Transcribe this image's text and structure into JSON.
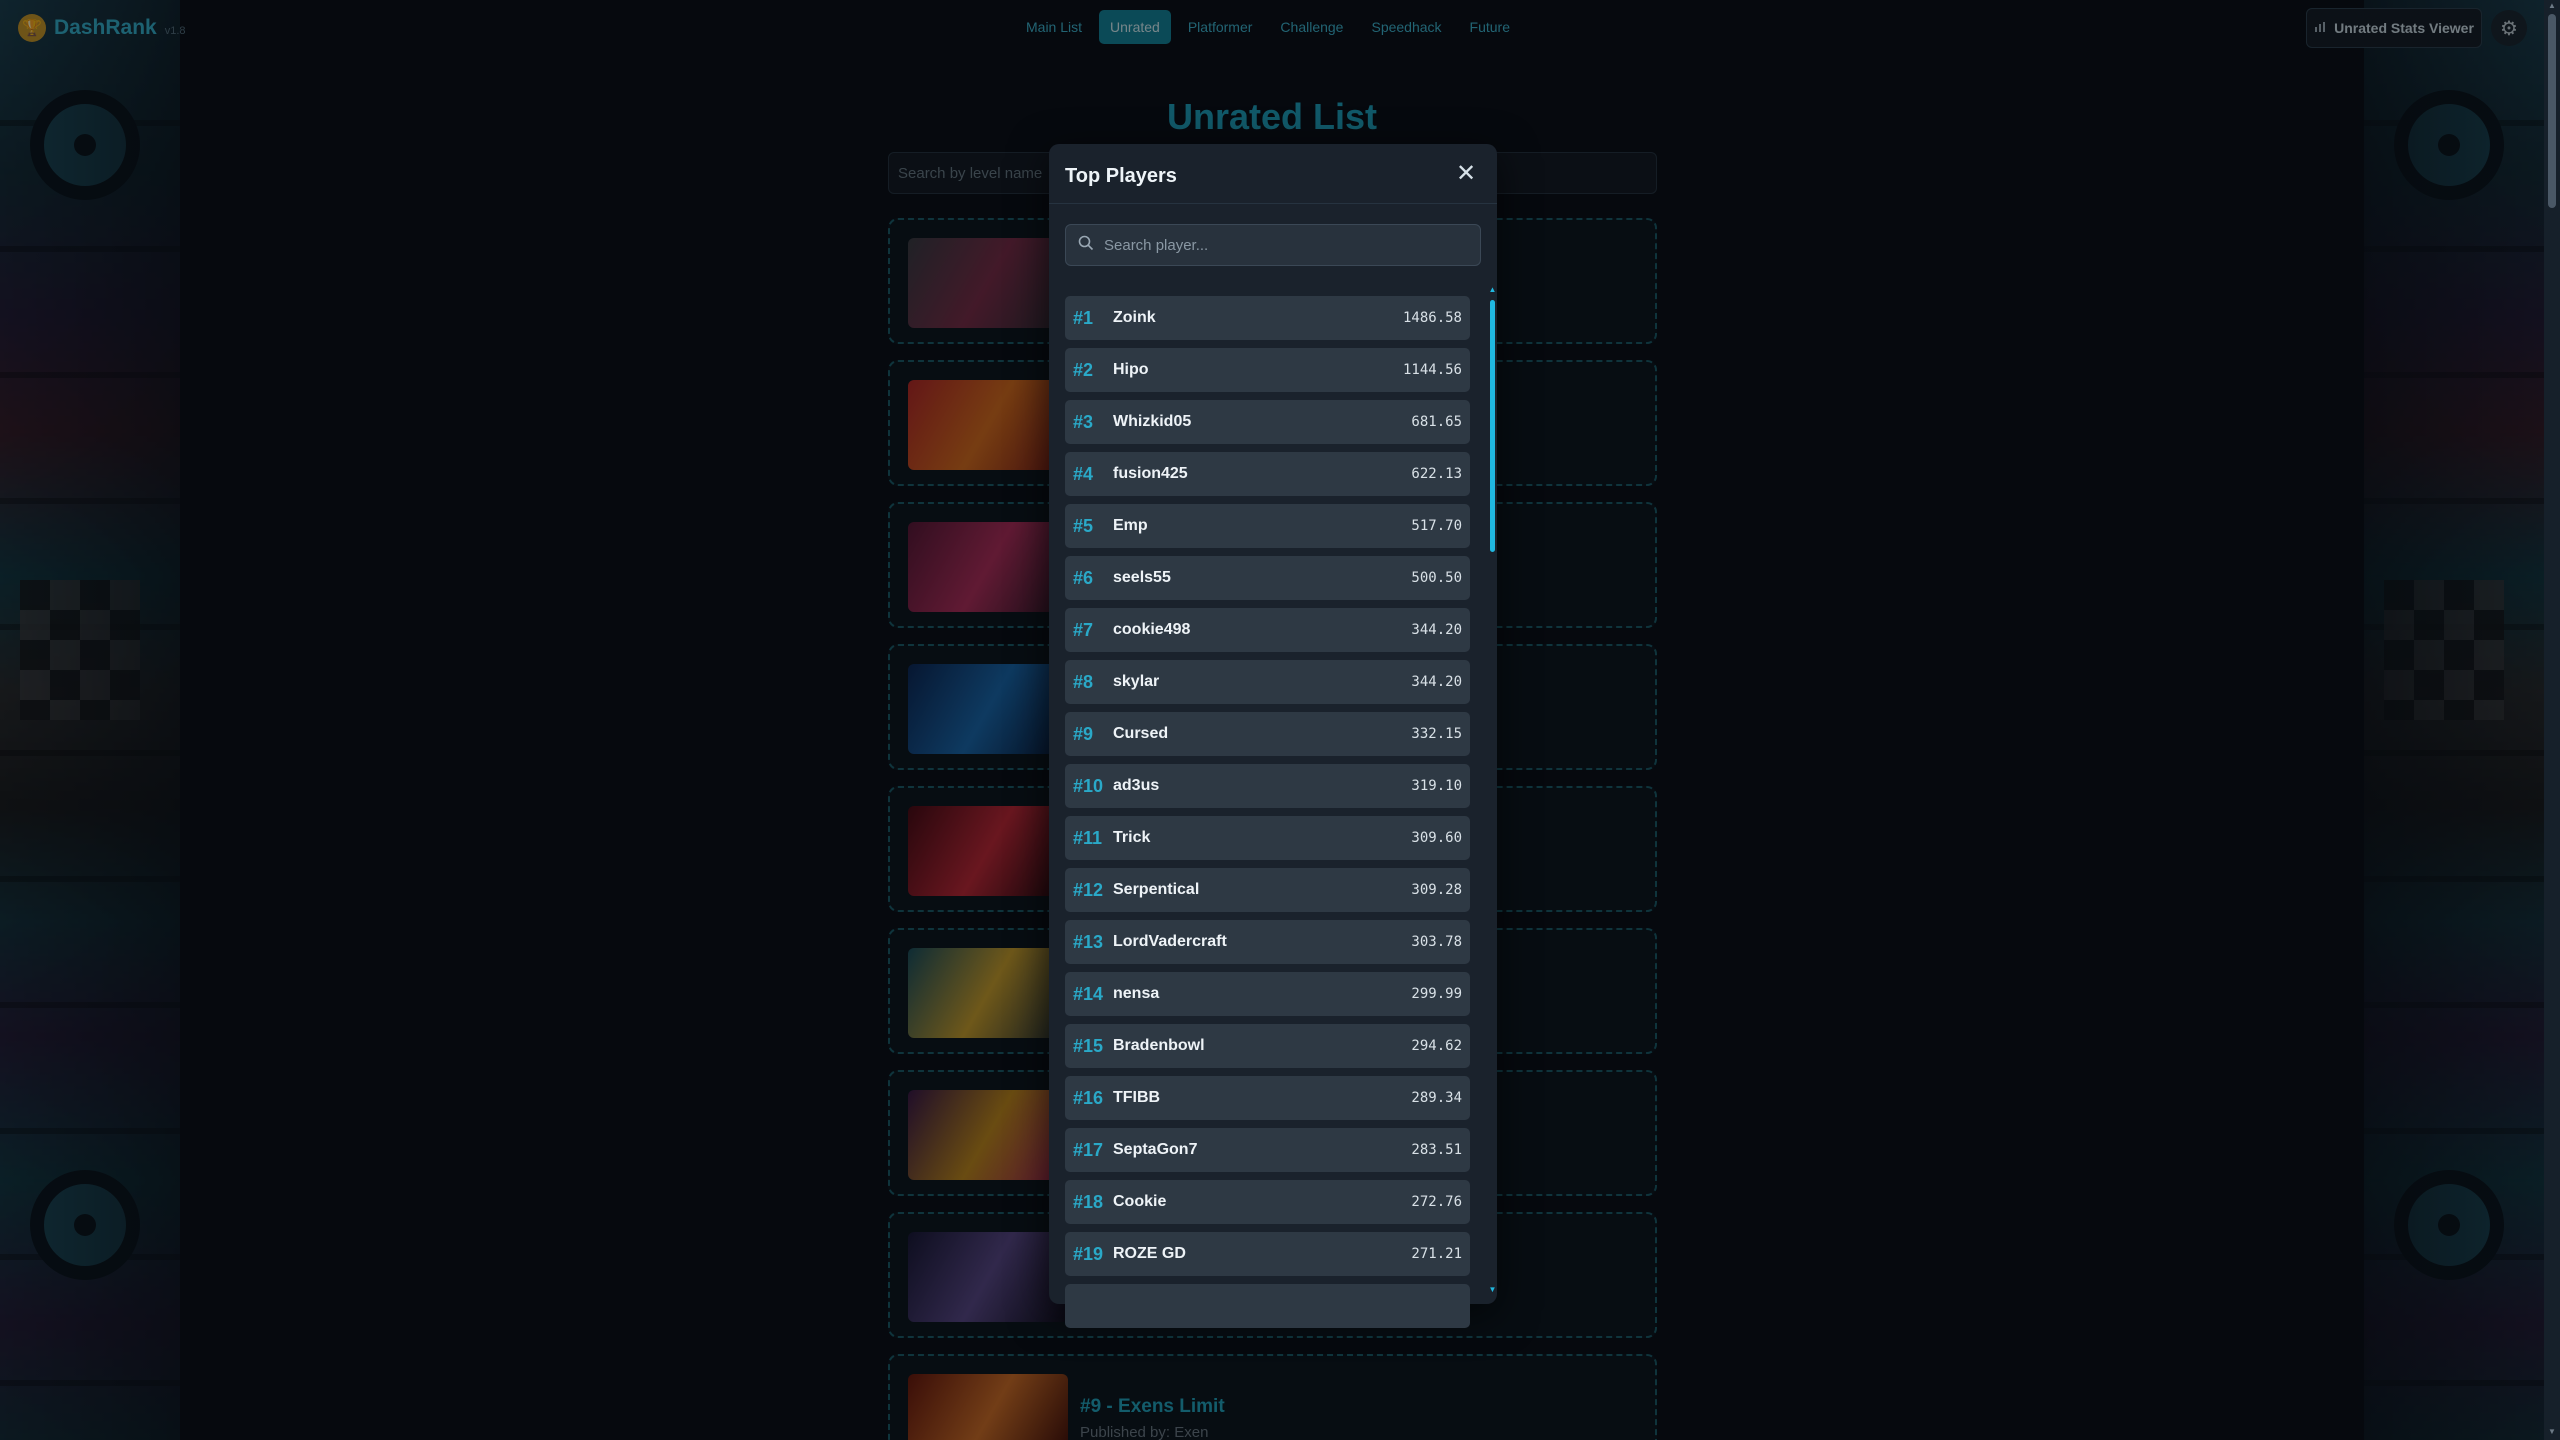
{
  "brand": {
    "name": "DashRank",
    "version": "v1.8"
  },
  "nav": {
    "items": [
      {
        "label": "Main List",
        "active": false
      },
      {
        "label": "Unrated",
        "active": true
      },
      {
        "label": "Platformer",
        "active": false
      },
      {
        "label": "Challenge",
        "active": false
      },
      {
        "label": "Speedhack",
        "active": false
      },
      {
        "label": "Future",
        "active": false
      }
    ]
  },
  "header": {
    "stats_button_label": "Unrated Stats Viewer",
    "stats_icon": "bar-chart-icon",
    "settings_icon": "gear-icon"
  },
  "main": {
    "title": "Unrated List",
    "search_placeholder": "Search by level name",
    "visible_card": {
      "title": "#9 - Exens Limit",
      "publisher": "Published by: Exen"
    }
  },
  "modal": {
    "title": "Top Players",
    "search_placeholder": "Search player...",
    "players": [
      {
        "rank": "#1",
        "name": "Zoink",
        "score": "1486.58"
      },
      {
        "rank": "#2",
        "name": "Hipo",
        "score": "1144.56"
      },
      {
        "rank": "#3",
        "name": "Whizkid05",
        "score": "681.65"
      },
      {
        "rank": "#4",
        "name": "fusion425",
        "score": "622.13"
      },
      {
        "rank": "#5",
        "name": "Emp",
        "score": "517.70"
      },
      {
        "rank": "#6",
        "name": "seels55",
        "score": "500.50"
      },
      {
        "rank": "#7",
        "name": "cookie498",
        "score": "344.20"
      },
      {
        "rank": "#8",
        "name": "skylar",
        "score": "344.20"
      },
      {
        "rank": "#9",
        "name": "Cursed",
        "score": "332.15"
      },
      {
        "rank": "#10",
        "name": "ad3us",
        "score": "319.10"
      },
      {
        "rank": "#11",
        "name": "Trick",
        "score": "309.60"
      },
      {
        "rank": "#12",
        "name": "Serpentical",
        "score": "309.28"
      },
      {
        "rank": "#13",
        "name": "LordVadercraft",
        "score": "303.78"
      },
      {
        "rank": "#14",
        "name": "nensa",
        "score": "299.99"
      },
      {
        "rank": "#15",
        "name": "Bradenbowl",
        "score": "294.62"
      },
      {
        "rank": "#16",
        "name": "TFIBB",
        "score": "289.34"
      },
      {
        "rank": "#17",
        "name": "SeptaGon7",
        "score": "283.51"
      },
      {
        "rank": "#18",
        "name": "Cookie",
        "score": "272.76"
      },
      {
        "rank": "#19",
        "name": "ROZE GD",
        "score": "271.21"
      },
      {
        "rank": "",
        "name": "",
        "score": ""
      }
    ]
  },
  "colors": {
    "accent": "#20a3c0",
    "active_tab": "#14879e",
    "background": "#0b121b",
    "modal_bg": "#1a222c",
    "row_bg": "#2e3944"
  }
}
